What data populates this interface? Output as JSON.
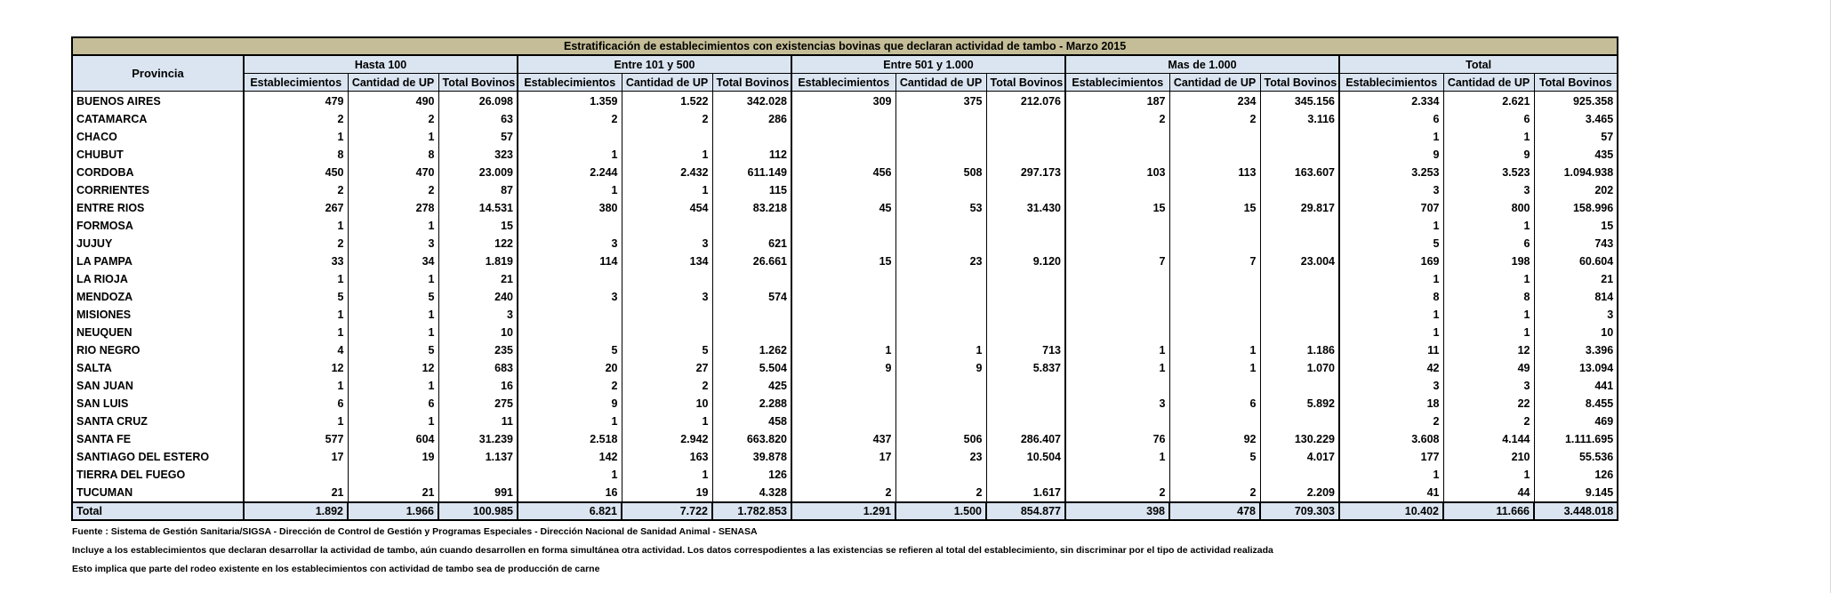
{
  "title": "Estratificación de establecimientos con existencias bovinas que declaran actividad de tambo - Marzo 2015",
  "province_header": "Provincia",
  "groups": [
    "Hasta 100",
    "Entre 101 y 500",
    "Entre 501  y 1.000",
    "Mas de 1.000",
    "Total"
  ],
  "subheaders": [
    "Establecimientos",
    "Cantidad de UP",
    "Total Bovinos"
  ],
  "rows": [
    [
      "BUENOS AIRES",
      "479",
      "490",
      "26.098",
      "1.359",
      "1.522",
      "342.028",
      "309",
      "375",
      "212.076",
      "187",
      "234",
      "345.156",
      "2.334",
      "2.621",
      "925.358"
    ],
    [
      "CATAMARCA",
      "2",
      "2",
      "63",
      "2",
      "2",
      "286",
      "",
      "",
      "",
      "2",
      "2",
      "3.116",
      "6",
      "6",
      "3.465"
    ],
    [
      "CHACO",
      "1",
      "1",
      "57",
      "",
      "",
      "",
      "",
      "",
      "",
      "",
      "",
      "",
      "1",
      "1",
      "57"
    ],
    [
      "CHUBUT",
      "8",
      "8",
      "323",
      "1",
      "1",
      "112",
      "",
      "",
      "",
      "",
      "",
      "",
      "9",
      "9",
      "435"
    ],
    [
      "CORDOBA",
      "450",
      "470",
      "23.009",
      "2.244",
      "2.432",
      "611.149",
      "456",
      "508",
      "297.173",
      "103",
      "113",
      "163.607",
      "3.253",
      "3.523",
      "1.094.938"
    ],
    [
      "CORRIENTES",
      "2",
      "2",
      "87",
      "1",
      "1",
      "115",
      "",
      "",
      "",
      "",
      "",
      "",
      "3",
      "3",
      "202"
    ],
    [
      "ENTRE RIOS",
      "267",
      "278",
      "14.531",
      "380",
      "454",
      "83.218",
      "45",
      "53",
      "31.430",
      "15",
      "15",
      "29.817",
      "707",
      "800",
      "158.996"
    ],
    [
      "FORMOSA",
      "1",
      "1",
      "15",
      "",
      "",
      "",
      "",
      "",
      "",
      "",
      "",
      "",
      "1",
      "1",
      "15"
    ],
    [
      "JUJUY",
      "2",
      "3",
      "122",
      "3",
      "3",
      "621",
      "",
      "",
      "",
      "",
      "",
      "",
      "5",
      "6",
      "743"
    ],
    [
      "LA PAMPA",
      "33",
      "34",
      "1.819",
      "114",
      "134",
      "26.661",
      "15",
      "23",
      "9.120",
      "7",
      "7",
      "23.004",
      "169",
      "198",
      "60.604"
    ],
    [
      "LA RIOJA",
      "1",
      "1",
      "21",
      "",
      "",
      "",
      "",
      "",
      "",
      "",
      "",
      "",
      "1",
      "1",
      "21"
    ],
    [
      "MENDOZA",
      "5",
      "5",
      "240",
      "3",
      "3",
      "574",
      "",
      "",
      "",
      "",
      "",
      "",
      "8",
      "8",
      "814"
    ],
    [
      "MISIONES",
      "1",
      "1",
      "3",
      "",
      "",
      "",
      "",
      "",
      "",
      "",
      "",
      "",
      "1",
      "1",
      "3"
    ],
    [
      "NEUQUEN",
      "1",
      "1",
      "10",
      "",
      "",
      "",
      "",
      "",
      "",
      "",
      "",
      "",
      "1",
      "1",
      "10"
    ],
    [
      "RIO NEGRO",
      "4",
      "5",
      "235",
      "5",
      "5",
      "1.262",
      "1",
      "1",
      "713",
      "1",
      "1",
      "1.186",
      "11",
      "12",
      "3.396"
    ],
    [
      "SALTA",
      "12",
      "12",
      "683",
      "20",
      "27",
      "5.504",
      "9",
      "9",
      "5.837",
      "1",
      "1",
      "1.070",
      "42",
      "49",
      "13.094"
    ],
    [
      "SAN JUAN",
      "1",
      "1",
      "16",
      "2",
      "2",
      "425",
      "",
      "",
      "",
      "",
      "",
      "",
      "3",
      "3",
      "441"
    ],
    [
      "SAN LUIS",
      "6",
      "6",
      "275",
      "9",
      "10",
      "2.288",
      "",
      "",
      "",
      "3",
      "6",
      "5.892",
      "18",
      "22",
      "8.455"
    ],
    [
      "SANTA CRUZ",
      "1",
      "1",
      "11",
      "1",
      "1",
      "458",
      "",
      "",
      "",
      "",
      "",
      "",
      "2",
      "2",
      "469"
    ],
    [
      "SANTA FE",
      "577",
      "604",
      "31.239",
      "2.518",
      "2.942",
      "663.820",
      "437",
      "506",
      "286.407",
      "76",
      "92",
      "130.229",
      "3.608",
      "4.144",
      "1.111.695"
    ],
    [
      "SANTIAGO DEL ESTERO",
      "17",
      "19",
      "1.137",
      "142",
      "163",
      "39.878",
      "17",
      "23",
      "10.504",
      "1",
      "5",
      "4.017",
      "177",
      "210",
      "55.536"
    ],
    [
      "TIERRA DEL FUEGO",
      "",
      "",
      "",
      "1",
      "1",
      "126",
      "",
      "",
      "",
      "",
      "",
      "",
      "1",
      "1",
      "126"
    ],
    [
      "TUCUMAN",
      "21",
      "21",
      "991",
      "16",
      "19",
      "4.328",
      "2",
      "2",
      "1.617",
      "2",
      "2",
      "2.209",
      "41",
      "44",
      "9.145"
    ]
  ],
  "total_row": [
    "Total",
    "1.892",
    "1.966",
    "100.985",
    "6.821",
    "7.722",
    "1.782.853",
    "1.291",
    "1.500",
    "854.877",
    "398",
    "478",
    "709.303",
    "10.402",
    "11.666",
    "3.448.018"
  ],
  "notes": [
    "Fuente : Sistema de Gestión Sanitaria/SIGSA - Dirección de Control de Gestión y Programas Especiales - Dirección Nacional de Sanidad Animal - SENASA",
    "Incluye a los establecimientos que declaran desarrollar la actividad de tambo, aún cuando desarrollen en forma simultánea otra actividad. Los datos correspodientes a las existencias se refieren al total del establecimiento, sin discriminar por el tipo de actividad realizada",
    "Esto implica que parte del rodeo existente en  los establecimientos con actividad de tambo sea de producción de carne"
  ]
}
